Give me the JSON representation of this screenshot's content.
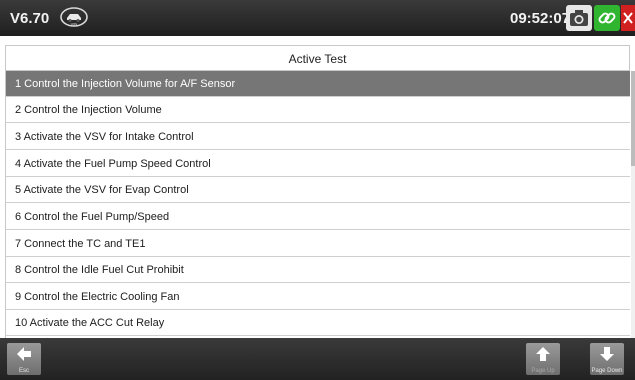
{
  "topbar": {
    "version": "V6.70",
    "time": "09:52:07"
  },
  "panel": {
    "title": "Active Test"
  },
  "items": [
    {
      "label": "1  Control the Injection Volume for A/F Sensor",
      "selected": true
    },
    {
      "label": "2  Control the Injection Volume",
      "selected": false
    },
    {
      "label": "3  Activate the VSV for Intake Control",
      "selected": false
    },
    {
      "label": "4  Activate the Fuel Pump Speed Control",
      "selected": false
    },
    {
      "label": "5  Activate the VSV for Evap Control",
      "selected": false
    },
    {
      "label": "6  Control the Fuel Pump/Speed",
      "selected": false
    },
    {
      "label": "7  Connect the TC and TE1",
      "selected": false
    },
    {
      "label": "8  Control the Idle Fuel Cut Prohibit",
      "selected": false
    },
    {
      "label": "9  Control the Electric Cooling Fan",
      "selected": false
    },
    {
      "label": "10 Activate the ACC Cut Relay",
      "selected": false
    }
  ],
  "bottombar": {
    "esc_label": "Esc",
    "page_up_label": "Page Up",
    "page_down_label": "Page Down"
  },
  "icons": {
    "vin": "vin-car-icon",
    "camera": "camera-icon",
    "link": "link-icon",
    "close": "close-icon",
    "esc": "arrow-left-icon",
    "page_up": "arrow-up-icon",
    "page_down": "arrow-down-icon"
  },
  "colors": {
    "selected_row": "#767676",
    "link_green": "#2fb52f",
    "close_red": "#d02020"
  }
}
